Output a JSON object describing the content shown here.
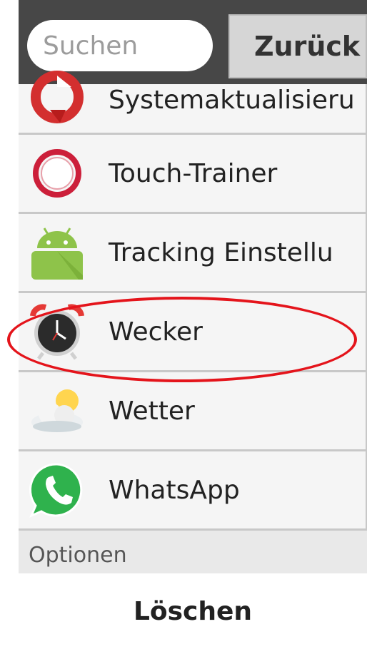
{
  "topbar": {
    "search_placeholder": "Suchen",
    "back_label": "Zurück"
  },
  "apps": [
    {
      "label": "Systemaktualisieru",
      "icon": "system-update-icon"
    },
    {
      "label": "Touch-Trainer",
      "icon": "touch-trainer-icon"
    },
    {
      "label": "Tracking Einstellu",
      "icon": "android-icon"
    },
    {
      "label": "Wecker",
      "icon": "alarm-clock-icon"
    },
    {
      "label": "Wetter",
      "icon": "weather-icon"
    },
    {
      "label": "WhatsApp",
      "icon": "whatsapp-icon"
    }
  ],
  "options": {
    "section_label": "Optionen",
    "delete_label": "Löschen"
  },
  "colors": {
    "topbar": "#474747",
    "highlight": "#e4141b",
    "whatsapp": "#2fb24d",
    "android": "#8ec34a"
  }
}
